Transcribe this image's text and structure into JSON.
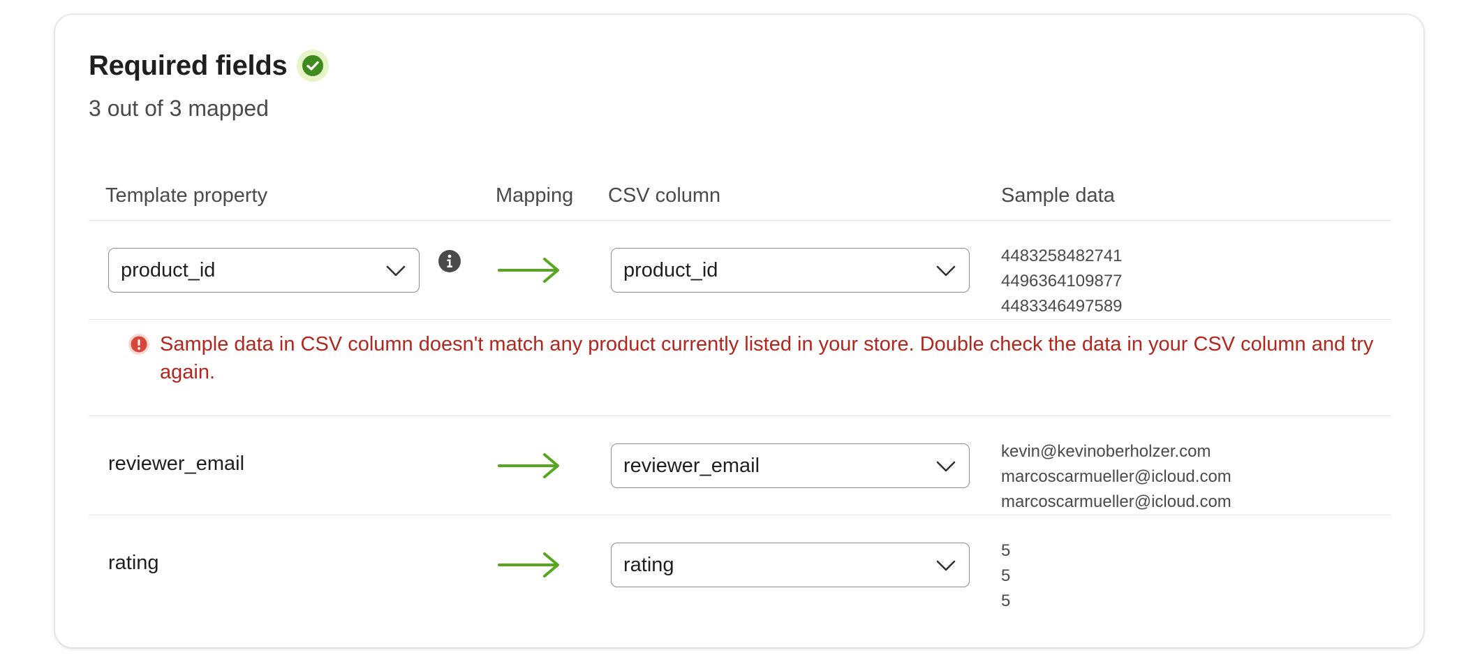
{
  "section": {
    "title": "Required fields",
    "status": "3 out of 3 mapped"
  },
  "columns": {
    "template_property": "Template property",
    "mapping": "Mapping",
    "csv_column": "CSV column",
    "sample_data": "Sample data"
  },
  "rows": [
    {
      "template_property": "product_id",
      "csv_column": "product_id",
      "samples": [
        "4483258482741",
        "4496364109877",
        "4483346497589"
      ]
    },
    {
      "template_property": "reviewer_email",
      "csv_column": "reviewer_email",
      "samples": [
        "kevin@kevinoberholzer.com",
        "marcoscarmueller@icloud.com",
        "marcoscarmueller@icloud.com"
      ]
    },
    {
      "template_property": "rating",
      "csv_column": "rating",
      "samples": [
        "5",
        "5",
        "5"
      ]
    }
  ],
  "error": {
    "message": "Sample data in CSV column doesn't match any product currently listed in your store. Double check the data in your CSV column and try again."
  },
  "icons": {
    "status": "check-circle-icon",
    "info": "info-icon",
    "error": "alert-circle-icon",
    "mapping": "arrow-right-icon",
    "dropdown": "chevron-down-icon"
  },
  "colors": {
    "success": "#3f8a1f",
    "arrow": "#56a61f",
    "error": "#b3261e"
  }
}
